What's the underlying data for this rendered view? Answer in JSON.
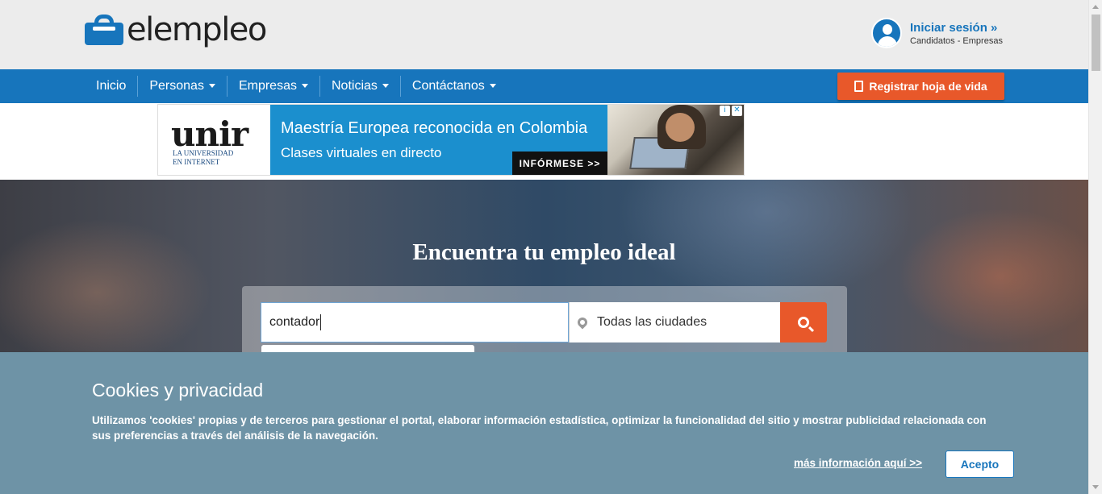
{
  "header": {
    "logo_text": "elempleo",
    "login": {
      "title": "Iniciar sesión »",
      "subtitle": "Candidatos - Empresas"
    }
  },
  "nav": {
    "items": [
      {
        "label": "Inicio",
        "has_dropdown": false
      },
      {
        "label": "Personas",
        "has_dropdown": true
      },
      {
        "label": "Empresas",
        "has_dropdown": true
      },
      {
        "label": "Noticias",
        "has_dropdown": true
      },
      {
        "label": "Contáctanos",
        "has_dropdown": true
      }
    ],
    "register_label": "Registrar hoja de vida"
  },
  "ad": {
    "brand": "unir",
    "tagline_1": "LA UNIVERSIDAD",
    "tagline_2": "EN INTERNET",
    "line1": "Maestría Europea reconocida en Colombia",
    "line2": "Clases virtuales en directo",
    "cta": "INFÓRMESE >>",
    "icons": [
      "info-icon",
      "close-icon"
    ]
  },
  "hero": {
    "title": "Encuentra tu empleo ideal",
    "search_value": "contador",
    "city_value": "Todas las ciudades"
  },
  "cookie": {
    "title": "Cookies y privacidad",
    "text": "Utilizamos 'cookies' propias y de terceros para gestionar el portal, elaborar información estadística, optimizar la funcionalidad del sitio y mostrar publicidad relacionada con sus preferencias a través del análisis de la navegación.",
    "link": "más información aquí >>",
    "accept": "Acepto"
  },
  "colors": {
    "brand_blue": "#1775bc",
    "accent_orange": "#e8582a",
    "cookie_bg": "#6e93a6",
    "ad_blue": "#1b8fce"
  }
}
